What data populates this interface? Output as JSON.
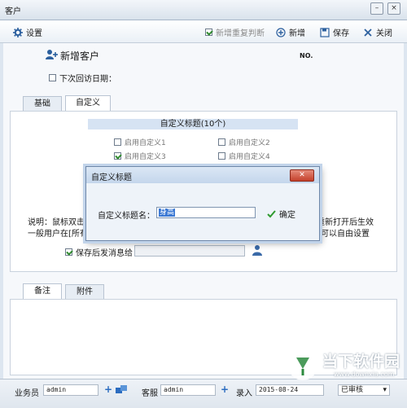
{
  "window": {
    "title": "客户"
  },
  "toolbar": {
    "settings_label": "设置",
    "dup_check_label": "新增重复判断",
    "new_label": "新增",
    "save_label": "保存",
    "close_label": "关闭"
  },
  "header": {
    "title": "新增客户",
    "no_label": "NO."
  },
  "next_visit": {
    "label": "下次回访日期：",
    "checked": false
  },
  "tabs": [
    {
      "label": "基础"
    },
    {
      "label": "自定义"
    }
  ],
  "custom": {
    "section_title": "自定义标题(10个)",
    "options": [
      {
        "label": "启用自定义1",
        "checked": false
      },
      {
        "label": "启用自定义2",
        "checked": false
      },
      {
        "label": "启用自定义3",
        "checked": true
      },
      {
        "label": "启用自定义4",
        "checked": false
      }
    ],
    "note_line1_left": "说明：鼠标双击",
    "note_line1_right": "重新打开后生效",
    "note_line2_left": "一般用户在[所有",
    "note_line2_right": "可以自由设置",
    "save_notify_label": "保存后发消息给",
    "save_notify_checked": true
  },
  "dialog": {
    "title": "自定义标题",
    "field_label": "自定义标题名：",
    "field_value": "身高",
    "ok_label": "确定"
  },
  "bottom_tabs": [
    {
      "label": "备注"
    },
    {
      "label": "附件"
    }
  ],
  "statusbar": {
    "salesman_label": "业务员",
    "salesman_value": "admin",
    "service_label": "客服",
    "service_value": "admin",
    "entry_label": "录入",
    "entry_date": "2015-08-24",
    "status_value": "已审核"
  },
  "watermark": {
    "text": "当下软件园",
    "url": "www.downxia.com"
  },
  "colors": {
    "accent": "#3a78d4",
    "section_header": "#d6e3f3",
    "check": "#2f8a2f"
  }
}
